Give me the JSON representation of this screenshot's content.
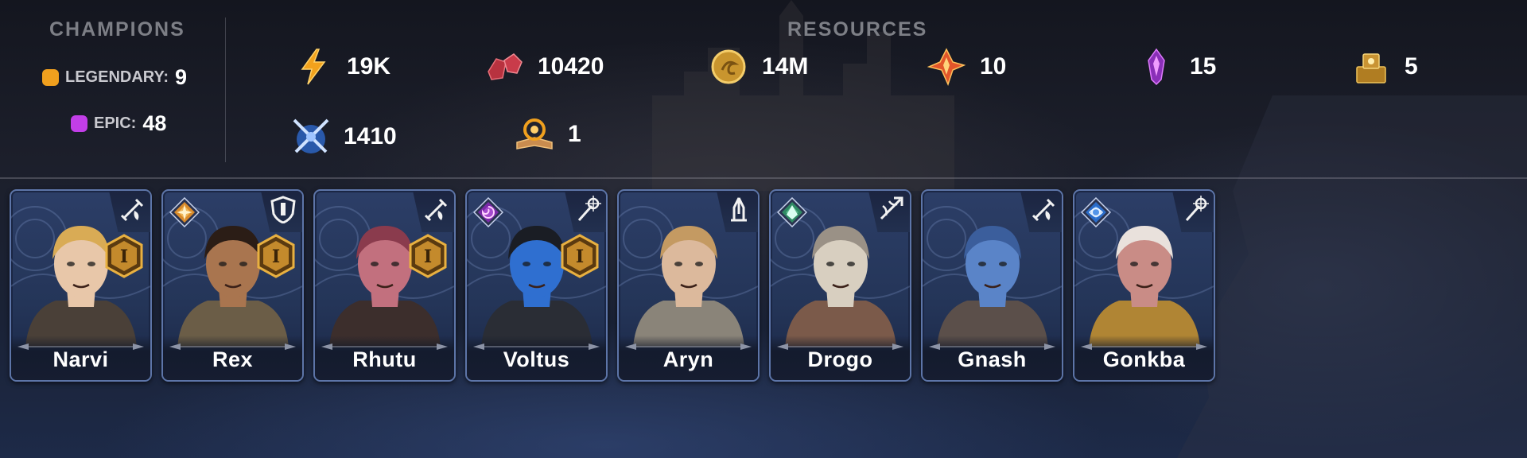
{
  "champions": {
    "title": "CHAMPIONS",
    "legendary": {
      "label": "LEGENDARY:",
      "count": "9",
      "color": "#f0a01e"
    },
    "epic": {
      "label": "EPIC:",
      "count": "48",
      "color": "#c23ee8"
    }
  },
  "resources": {
    "title": "RESOURCES",
    "items": [
      {
        "icon": "energy-icon",
        "value": "19K"
      },
      {
        "icon": "gems-icon",
        "value": "10420"
      },
      {
        "icon": "silver-coin-icon",
        "value": "14M"
      },
      {
        "icon": "sacred-shard-icon",
        "value": "10"
      },
      {
        "icon": "void-shard-icon",
        "value": "15"
      },
      {
        "icon": "gold-tome-icon",
        "value": "5"
      },
      {
        "icon": "arena-tokens-icon",
        "value": "1410"
      },
      {
        "icon": "skill-book-icon",
        "value": "1"
      }
    ]
  },
  "cards": [
    {
      "name": "Narvi",
      "role": "attack-role-icon",
      "affinity": "none",
      "rank": "I",
      "skin": "#e8c7a9",
      "hair": "#d9ab55",
      "armor": "#4a4038"
    },
    {
      "name": "Rex",
      "role": "defense-role-icon",
      "affinity": "force",
      "rank": "I",
      "skin": "#a9754f",
      "hair": "#2b1d16",
      "armor": "#6b5d47"
    },
    {
      "name": "Rhutu",
      "role": "attack-role-icon",
      "affinity": "none",
      "rank": "I",
      "skin": "#c2707e",
      "hair": "#8a3b4d",
      "armor": "#3c2e2c"
    },
    {
      "name": "Voltus",
      "role": "magic-role-icon",
      "affinity": "void",
      "rank": "I",
      "skin": "#2f6fd0",
      "hair": "#1a1d24",
      "armor": "#2a2d35"
    },
    {
      "name": "Aryn",
      "role": "support-role-icon",
      "affinity": "none",
      "rank": "",
      "skin": "#dcb99c",
      "hair": "#c49a62",
      "armor": "#8a8479"
    },
    {
      "name": "Drogo",
      "role": "hp-role-icon",
      "affinity": "spirit",
      "rank": "",
      "skin": "#d8cfc0",
      "hair": "#9a9186",
      "armor": "#7b5a4a"
    },
    {
      "name": "Gnash",
      "role": "attack-role-icon",
      "affinity": "none",
      "rank": "",
      "skin": "#5a84c8",
      "hair": "#3b5e9c",
      "armor": "#5b4f4a"
    },
    {
      "name": "Gonkba",
      "role": "magic-role-icon",
      "affinity": "magic",
      "rank": "",
      "skin": "#c98c86",
      "hair": "#e9e1dc",
      "armor": "#b08534"
    }
  ]
}
